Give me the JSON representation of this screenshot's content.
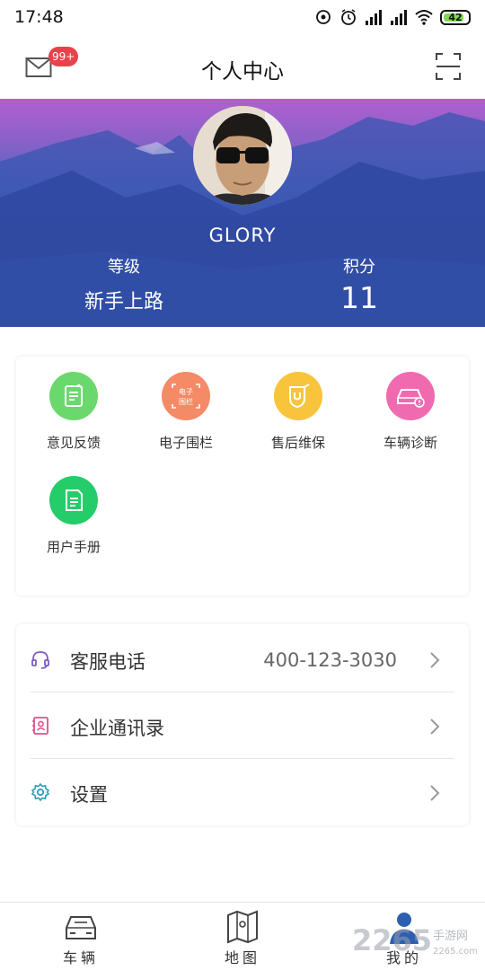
{
  "status_bar": {
    "time": "17:48",
    "battery": "42"
  },
  "header": {
    "title": "个人中心",
    "mail_badge": "99+"
  },
  "profile": {
    "username": "GLORY",
    "level_label": "等级",
    "level_value": "新手上路",
    "points_label": "积分",
    "points_value": "11"
  },
  "functions": [
    {
      "label": "意见反馈",
      "icon": "feedback-icon",
      "color": "#6bd86e"
    },
    {
      "label": "电子围栏",
      "icon": "fence-icon",
      "color": "#f58a66",
      "icon_text": "电子围栏"
    },
    {
      "label": "售后维保",
      "icon": "maintenance-icon",
      "color": "#f8c43c"
    },
    {
      "label": "车辆诊断",
      "icon": "diagnosis-icon",
      "color": "#f06ab0"
    },
    {
      "label": "用户手册",
      "icon": "manual-icon",
      "color": "#25cc6a"
    }
  ],
  "list": [
    {
      "label": "客服电话",
      "value": "400-123-3030",
      "icon": "headset-icon",
      "icon_color": "#7b5cc8"
    },
    {
      "label": "企业通讯录",
      "value": "",
      "icon": "contacts-icon",
      "icon_color": "#e0508a"
    },
    {
      "label": "设置",
      "value": "",
      "icon": "gear-icon",
      "icon_color": "#2a9fb8"
    }
  ],
  "bottom_nav": [
    {
      "label": "车辆",
      "icon": "car-icon"
    },
    {
      "label": "地图",
      "icon": "map-icon"
    },
    {
      "label": "我的",
      "icon": "profile-icon",
      "active": true
    }
  ],
  "watermark": {
    "text": "2265",
    "suffix": "手游网",
    "url": "2265.com"
  }
}
